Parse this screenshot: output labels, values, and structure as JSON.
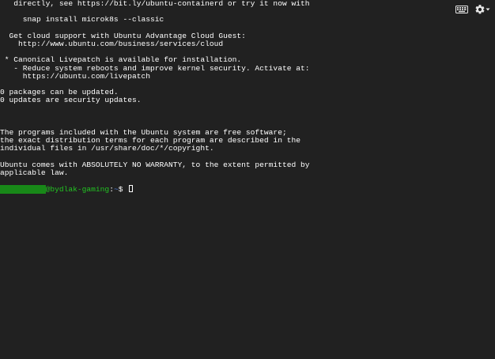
{
  "terminal": {
    "lines": [
      "   directly, see https://bit.ly/ubuntu-containerd or try it now with",
      "",
      "     snap install microk8s --classic",
      "",
      "  Get cloud support with Ubuntu Advantage Cloud Guest:",
      "    http://www.ubuntu.com/business/services/cloud",
      "",
      " * Canonical Livepatch is available for installation.",
      "   - Reduce system reboots and improve kernel security. Activate at:",
      "     https://ubuntu.com/livepatch",
      "",
      "0 packages can be updated.",
      "0 updates are security updates.",
      "",
      "",
      "",
      "The programs included with the Ubuntu system are free software;",
      "the exact distribution terms for each program are described in the",
      "individual files in /usr/share/doc/*/copyright.",
      "",
      "Ubuntu comes with ABSOLUTELY NO WARRANTY, to the extent permitted by",
      "applicable law.",
      ""
    ],
    "prompt": {
      "user": "          ",
      "at_host": "@bydlak-gaming",
      "colon": ":",
      "path": "~",
      "symbol": "$ "
    }
  },
  "toolbar": {
    "keyboard_icon": "keyboard-icon",
    "settings_icon": "gear-icon",
    "colors": {
      "icon": "#e8e8e8"
    }
  },
  "colors": {
    "background": "#212121",
    "text": "#ffffff",
    "host": "#22c422",
    "path": "#4f7fe0"
  }
}
